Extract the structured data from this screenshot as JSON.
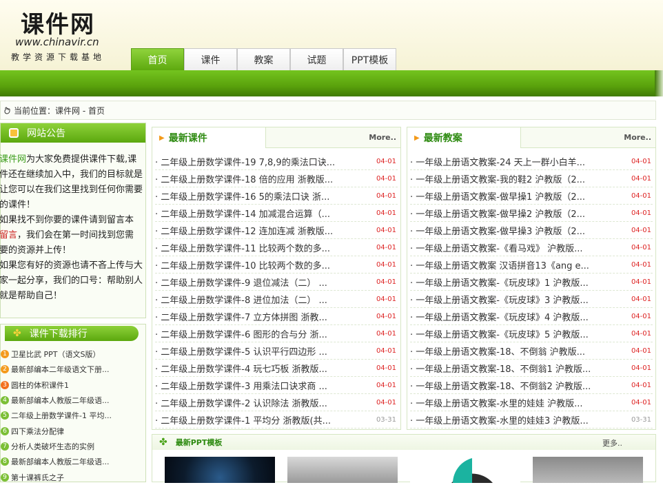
{
  "header": {
    "logo_title": "课件网",
    "logo_url": "www.chinavir.cn",
    "logo_slogan": "教学资源下载基地"
  },
  "nav": {
    "tabs": [
      {
        "label": "首页",
        "active": true
      },
      {
        "label": "课件",
        "active": false
      },
      {
        "label": "教案",
        "active": false
      },
      {
        "label": "试题",
        "active": false
      },
      {
        "label": "PPT模板",
        "active": false
      }
    ]
  },
  "breadcrumb": {
    "text": "当前位置：课件网 - 首页"
  },
  "notice": {
    "title": "网站公告",
    "p1_a": "课件网",
    "p1_b": "为大家免费提供课件下载,课件还在继续加入中，我们的目标就是让您可以在我们这里找到任何你需要的课件！",
    "p2_a": "如果找不到你要的课件请到留言本",
    "p2_b": "留言",
    "p2_c": "，我们会在第一时间找到您需要的资源并上传！",
    "p3": "如果您有好的资源也请不吝上传与大家一起分享，我们的口号：帮助别人就是帮助自己！"
  },
  "rank": {
    "title": "课件下载排行",
    "items": [
      "卫星比武 PPT（语文S版）",
      "最新部编本二年级语文下册...",
      "圆柱的体积课件1",
      "最新部编本人教版二年级语...",
      "二年级上册数学课件-1 平均...",
      "四下乘法分配律",
      "分析人类破坏生态的实例",
      "最新部编本人教版二年级语...",
      "第十课裤氏之子"
    ]
  },
  "latest_courseware": {
    "title": "最新课件",
    "more": "More..",
    "items": [
      {
        "t": "二年级上册数学课件-19 7,8,9的乘法口诀...",
        "d": "04-01"
      },
      {
        "t": "二年级上册数学课件-18 倍的应用 浙教版...",
        "d": "04-01"
      },
      {
        "t": "二年级上册数学课件-16 5的乘法口诀 浙...",
        "d": "04-01"
      },
      {
        "t": "二年级上册数学课件-14 加减混合运算（...",
        "d": "04-01"
      },
      {
        "t": "二年级上册数学课件-12 连加连减 浙教版...",
        "d": "04-01"
      },
      {
        "t": "二年级上册数学课件-11 比较两个数的多...",
        "d": "04-01"
      },
      {
        "t": "二年级上册数学课件-10 比较两个数的多...",
        "d": "04-01"
      },
      {
        "t": "二年级上册数学课件-9 退位减法（二） ...",
        "d": "04-01"
      },
      {
        "t": "二年级上册数学课件-8 进位加法（二） ...",
        "d": "04-01"
      },
      {
        "t": "二年级上册数学课件-7 立方体拼图 浙教...",
        "d": "04-01"
      },
      {
        "t": "二年级上册数学课件-6 图形的合与分 浙...",
        "d": "04-01"
      },
      {
        "t": "二年级上册数学课件-5 认识平行四边形 ...",
        "d": "04-01"
      },
      {
        "t": "二年级上册数学课件-4 玩七巧板 浙教版...",
        "d": "04-01"
      },
      {
        "t": "二年级上册数学课件-3 用乘法口诀求商 ...",
        "d": "04-01"
      },
      {
        "t": "二年级上册数学课件-2 认识除法 浙教版...",
        "d": "04-01"
      },
      {
        "t": "二年级上册数学课件-1 平均分 浙教版(共...",
        "d": "03-31"
      }
    ]
  },
  "latest_plans": {
    "title": "最新教案",
    "more": "More..",
    "items": [
      {
        "t": "一年级上册语文教案-24 天上一群小白羊...",
        "d": "04-01"
      },
      {
        "t": "一年级上册语文教案-我的鞋2 沪教版（2...",
        "d": "04-01"
      },
      {
        "t": "一年级上册语文教案-做早操1 沪教版（2...",
        "d": "04-01"
      },
      {
        "t": "一年级上册语文教案-做早操2 沪教版（2...",
        "d": "04-01"
      },
      {
        "t": "一年级上册语文教案-做早操3 沪教版（2...",
        "d": "04-01"
      },
      {
        "t": "一年级上册语文教案-《看马戏》 沪教版...",
        "d": "04-01"
      },
      {
        "t": "一年级上册语文教案 汉语拼音13《ang e...",
        "d": "04-01"
      },
      {
        "t": "一年级上册语文教案-《玩皮球》1 沪教版...",
        "d": "04-01"
      },
      {
        "t": "一年级上册语文教案-《玩皮球》3 沪教版...",
        "d": "04-01"
      },
      {
        "t": "一年级上册语文教案-《玩皮球》4 沪教版...",
        "d": "04-01"
      },
      {
        "t": "一年级上册语文教案-《玩皮球》5 沪教版...",
        "d": "04-01"
      },
      {
        "t": "一年级上册语文教案-18、不倒翁 沪教版...",
        "d": "04-01"
      },
      {
        "t": "一年级上册语文教案-18、不倒翁1 沪教版...",
        "d": "04-01"
      },
      {
        "t": "一年级上册语文教案-18、不倒翁2 沪教版...",
        "d": "04-01"
      },
      {
        "t": "一年级上册语文教案-水里的娃娃 沪教版...",
        "d": "04-01"
      },
      {
        "t": "一年级上册语文教案-水里的娃娃3 沪教版...",
        "d": "03-31"
      }
    ]
  },
  "ppt": {
    "title": "最新PPT模板",
    "more": "更多.."
  }
}
